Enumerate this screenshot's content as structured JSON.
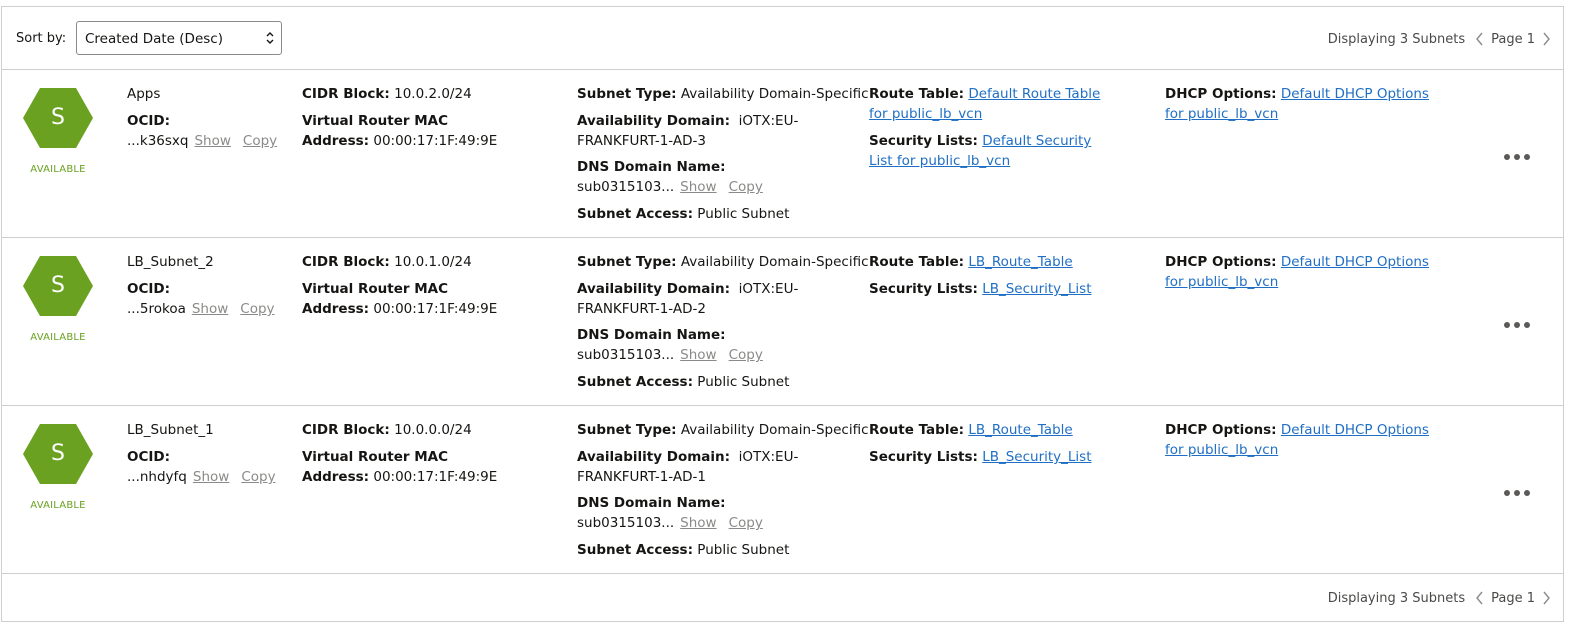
{
  "toolbar": {
    "sort_label": "Sort by:",
    "sort_value": "Created Date (Desc)",
    "displaying": "Displaying 3 Subnets",
    "page": "Page 1"
  },
  "labels": {
    "ocid": "OCID:",
    "show": "Show",
    "copy": "Copy",
    "cidr": "CIDR Block:",
    "vr_mac_1": "Virtual Router MAC",
    "vr_mac_2": "Address:",
    "subnet_type": "Subnet Type:",
    "availability_domain": "Availability Domain:",
    "dns": "DNS Domain Name:",
    "subnet_access": "Subnet Access:",
    "route_table": "Route Table:",
    "security_lists": "Security Lists:",
    "dhcp": "DHCP Options:"
  },
  "subnets": [
    {
      "letter": "S",
      "status": "AVAILABLE",
      "name": "Apps",
      "ocid": "...k36sxq",
      "cidr": "10.0.2.0/24",
      "mac": "00:00:17:1F:49:9E",
      "subnet_type": "Availability Domain-Specific",
      "ad_line1": "iOTX:EU-",
      "ad_line2": "FRANKFURT-1-AD-3",
      "dns": "sub0315103...",
      "access": "Public Subnet",
      "route_table": "Default Route Table for public_lb_vcn",
      "security_list": "Default Security List for public_lb_vcn",
      "dhcp": "Default DHCP Options for public_lb_vcn"
    },
    {
      "letter": "S",
      "status": "AVAILABLE",
      "name": "LB_Subnet_2",
      "ocid": "...5rokoa",
      "cidr": "10.0.1.0/24",
      "mac": "00:00:17:1F:49:9E",
      "subnet_type": "Availability Domain-Specific",
      "ad_line1": "iOTX:EU-",
      "ad_line2": "FRANKFURT-1-AD-2",
      "dns": "sub0315103...",
      "access": "Public Subnet",
      "route_table": "LB_Route_Table",
      "security_list": "LB_Security_List",
      "dhcp": "Default DHCP Options for public_lb_vcn"
    },
    {
      "letter": "S",
      "status": "AVAILABLE",
      "name": "LB_Subnet_1",
      "ocid": "...nhdyfq",
      "cidr": "10.0.0.0/24",
      "mac": "00:00:17:1F:49:9E",
      "subnet_type": "Availability Domain-Specific",
      "ad_line1": "iOTX:EU-",
      "ad_line2": "FRANKFURT-1-AD-1",
      "dns": "sub0315103...",
      "access": "Public Subnet",
      "route_table": "LB_Route_Table",
      "security_list": "LB_Security_List",
      "dhcp": "Default DHCP Options for public_lb_vcn"
    }
  ],
  "colors": {
    "available_green": "#6aa121",
    "hex_fill": "#6aa121",
    "link_blue": "#1f6fc5"
  }
}
